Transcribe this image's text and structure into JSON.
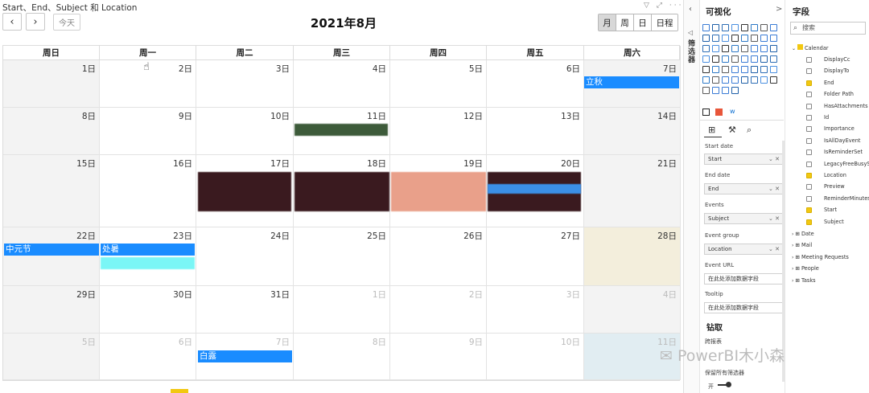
{
  "title": "Start、End、Subject 和 Location",
  "nav": {
    "prev": "‹",
    "next": "›",
    "today": "今天"
  },
  "month_title": "2021年8月",
  "views": [
    {
      "label": "月",
      "active": true
    },
    {
      "label": "周",
      "active": false
    },
    {
      "label": "日",
      "active": false
    },
    {
      "label": "日程",
      "active": false
    }
  ],
  "weekdays": [
    "周日",
    "周一",
    "周二",
    "周三",
    "周四",
    "周五",
    "周六"
  ],
  "weeks": [
    [
      "1日",
      "2日",
      "3日",
      "4日",
      "5日",
      "6日",
      "7日"
    ],
    [
      "8日",
      "9日",
      "10日",
      "11日",
      "12日",
      "13日",
      "14日"
    ],
    [
      "15日",
      "16日",
      "17日",
      "18日",
      "19日",
      "20日",
      "21日"
    ],
    [
      "22日",
      "23日",
      "24日",
      "25日",
      "26日",
      "27日",
      "28日"
    ],
    [
      "29日",
      "30日",
      "31日",
      "1日",
      "2日",
      "3日",
      "4日"
    ],
    [
      "5日",
      "6日",
      "7日",
      "8日",
      "9日",
      "10日",
      "11日"
    ]
  ],
  "events": {
    "liqiu": "立秋",
    "zhongyuan": "中元节",
    "chushu": "处暑",
    "bailu": "白露"
  },
  "viz": {
    "title": "可视化",
    "chevron": ">",
    "filters_label": "筛选器",
    "wells": {
      "start_date": "Start date",
      "start": "Start",
      "end_date": "End date",
      "end": "End",
      "events": "Events",
      "subject": "Subject",
      "event_group": "Event group",
      "location": "Location",
      "event_url": "Event URL",
      "event_url_ph": "在此处添加数据字段",
      "tooltip": "Tooltip",
      "tooltip_ph": "在此处添加数据字段"
    },
    "drill": "钻取",
    "cross_report": "跨报表",
    "keep_filters": "保留所有筛选器",
    "toggle": "开"
  },
  "fields": {
    "title": "字段",
    "search": "搜索",
    "table": "Calendar",
    "items": [
      {
        "name": "DisplayCc",
        "checked": false
      },
      {
        "name": "DisplayTo",
        "checked": false
      },
      {
        "name": "End",
        "checked": true
      },
      {
        "name": "Folder Path",
        "checked": false
      },
      {
        "name": "HasAttachments",
        "checked": false
      },
      {
        "name": "Id",
        "checked": false
      },
      {
        "name": "Importance",
        "checked": false
      },
      {
        "name": "IsAllDayEvent",
        "checked": false
      },
      {
        "name": "IsReminderSet",
        "checked": false
      },
      {
        "name": "LegacyFreeBusySt",
        "checked": false
      },
      {
        "name": "Location",
        "checked": true
      },
      {
        "name": "Preview",
        "checked": false
      },
      {
        "name": "ReminderMinutes",
        "checked": false
      },
      {
        "name": "Start",
        "checked": true
      },
      {
        "name": "Subject",
        "checked": true
      }
    ],
    "tables": [
      "Date",
      "Mail",
      "Meeting Requests",
      "People",
      "Tasks"
    ]
  },
  "watermark": "PowerBI木小森",
  "colors": {
    "event": "#1a8cff",
    "today": "#f3eedc",
    "weekend": "#f3f3f3",
    "selected": "#e1edf2",
    "check": "#f2c811"
  }
}
